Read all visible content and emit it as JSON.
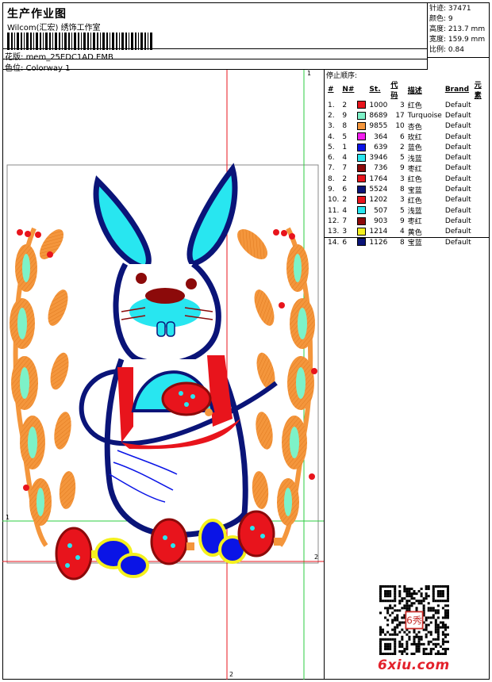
{
  "header": {
    "title": "生产作业图",
    "company": "Wilcom(汇宏) 绣饰工作室",
    "design_label": "花版:",
    "design_value": "mem_25EDC1AD.EMB",
    "colorway_label": "色位:",
    "colorway_value": "Colorway 1"
  },
  "stats": [
    {
      "label": "针迹:",
      "value": "37471"
    },
    {
      "label": "颜色:",
      "value": "9"
    },
    {
      "label": "高度:",
      "value": "213.7 mm"
    },
    {
      "label": "宽度:",
      "value": "159.9 mm"
    },
    {
      "label": "比例:",
      "value": "0.84"
    }
  ],
  "legend": {
    "title": "停止顺序:",
    "columns": [
      "#",
      "N#",
      "St.",
      "代码",
      "描述",
      "Brand",
      "元素"
    ],
    "rows": [
      {
        "idx": "1.",
        "n": "2",
        "color": "#e8141c",
        "st": "1000",
        "code": "3",
        "desc": "红色",
        "brand": "Default"
      },
      {
        "idx": "2.",
        "n": "9",
        "color": "#7df2c8",
        "st": "8689",
        "code": "17",
        "desc": "Turquoise",
        "brand": "Default"
      },
      {
        "idx": "3.",
        "n": "8",
        "color": "#f4963c",
        "st": "9855",
        "code": "10",
        "desc": "杏色",
        "brand": "Default"
      },
      {
        "idx": "4.",
        "n": "5",
        "color": "#f41ef0",
        "st": "364",
        "code": "6",
        "desc": "玫红",
        "brand": "Default"
      },
      {
        "idx": "5.",
        "n": "1",
        "color": "#0a14e6",
        "st": "639",
        "code": "2",
        "desc": "蓝色",
        "brand": "Default"
      },
      {
        "idx": "6.",
        "n": "4",
        "color": "#28e6f0",
        "st": "3946",
        "code": "5",
        "desc": "浅蓝",
        "brand": "Default"
      },
      {
        "idx": "7.",
        "n": "7",
        "color": "#8c0a0a",
        "st": "736",
        "code": "9",
        "desc": "枣红",
        "brand": "Default"
      },
      {
        "idx": "8.",
        "n": "2",
        "color": "#e8141c",
        "st": "1764",
        "code": "3",
        "desc": "红色",
        "brand": "Default"
      },
      {
        "idx": "9.",
        "n": "6",
        "color": "#0a1478",
        "st": "5524",
        "code": "8",
        "desc": "宝蓝",
        "brand": "Default"
      },
      {
        "idx": "10.",
        "n": "2",
        "color": "#e8141c",
        "st": "1202",
        "code": "3",
        "desc": "红色",
        "brand": "Default"
      },
      {
        "idx": "11.",
        "n": "4",
        "color": "#28e6f0",
        "st": "507",
        "code": "5",
        "desc": "浅蓝",
        "brand": "Default"
      },
      {
        "idx": "12.",
        "n": "7",
        "color": "#8c0a0a",
        "st": "903",
        "code": "9",
        "desc": "枣红",
        "brand": "Default"
      },
      {
        "idx": "13.",
        "n": "3",
        "color": "#f4f01e",
        "st": "1214",
        "code": "4",
        "desc": "黄色",
        "brand": "Default"
      },
      {
        "idx": "14.",
        "n": "6",
        "color": "#0a1478",
        "st": "1126",
        "code": "8",
        "desc": "宝蓝",
        "brand": "Default"
      }
    ]
  },
  "guides": {
    "v1_label": "1",
    "h1_label": "1",
    "v2_label": "2",
    "h2_label": "2"
  },
  "footer": {
    "logo_text": "6xiu.com",
    "seal_text": "6秀"
  },
  "icons": [
    "barcode-icon",
    "qr-code-icon",
    "embroidery-artwork"
  ]
}
